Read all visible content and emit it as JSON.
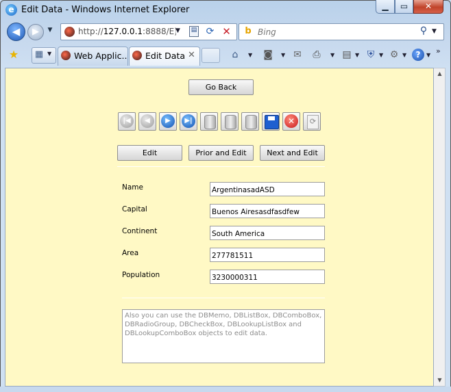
{
  "window": {
    "title": "Edit Data - Windows Internet Explorer",
    "icon": "ie-icon",
    "controls": {
      "minimize": "▁",
      "maximize": "▭",
      "close": "✕"
    }
  },
  "address_bar": {
    "url_prefix": "http://",
    "url_host": "127.0.0.1",
    "url_rest": ":8888/E)",
    "compat_icon": "compatibility-view-icon",
    "refresh_icon": "refresh-icon",
    "stop_icon": "stop-icon"
  },
  "search": {
    "placeholder": "Bing",
    "provider_icon": "bing-icon"
  },
  "tabs": [
    {
      "label": "Web Applic...",
      "active": false
    },
    {
      "label": "Edit Data",
      "active": true
    }
  ],
  "command_bar": {
    "icons": [
      "home-icon",
      "rss-feed-icon",
      "mail-icon",
      "print-icon",
      "page-icon",
      "safety-icon",
      "tools-icon",
      "help-icon"
    ]
  },
  "page": {
    "background": "#fff9c5",
    "go_back_label": "Go Back",
    "navigator": {
      "buttons": [
        "first",
        "prior",
        "next",
        "last",
        "insert",
        "add",
        "delete",
        "post",
        "cancel",
        "refresh"
      ]
    },
    "edit_label": "Edit",
    "prior_edit_label": "Prior and Edit",
    "next_edit_label": "Next and Edit",
    "fields": [
      {
        "label": "Name",
        "value": "ArgentinasadASD"
      },
      {
        "label": "Capital",
        "value": "Buenos Airesasdfasdfew"
      },
      {
        "label": "Continent",
        "value": "South America"
      },
      {
        "label": "Area",
        "value": "277781511"
      },
      {
        "label": "Population",
        "value": "3230000311"
      }
    ],
    "memo_text": "Also you can use the DBMemo, DBListBox, DBComboBox, DBRadioGroup, DBCheckBox, DBLookupListBox and DBLookupComboBox objects to edit data."
  }
}
